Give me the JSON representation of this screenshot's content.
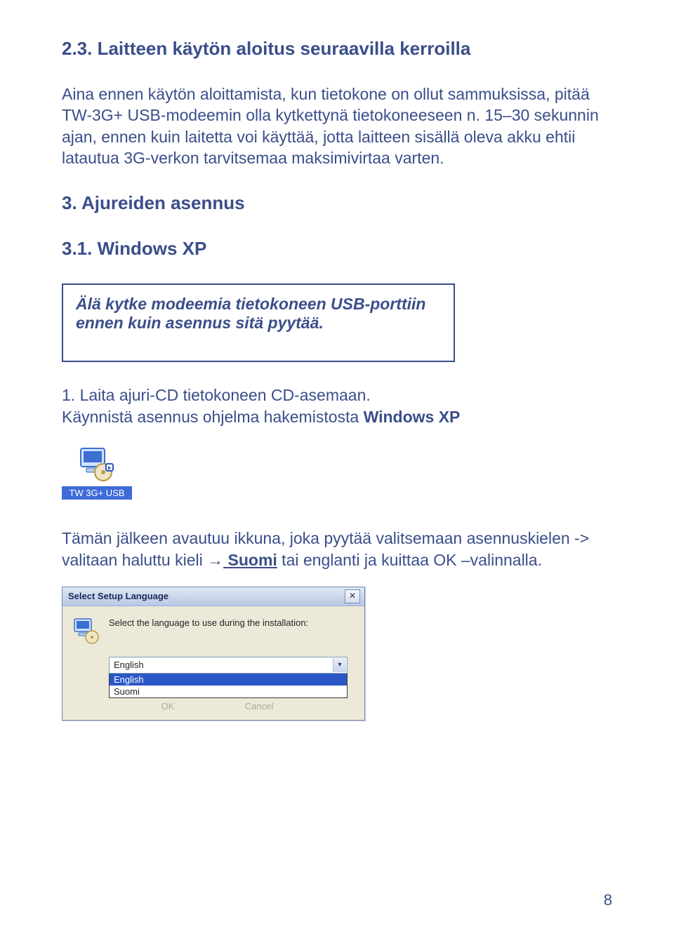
{
  "headings": {
    "h_23": "2.3. Laitteen käytön aloitus seuraavilla kerroilla",
    "h_3": "3. Ajureiden asennus",
    "h_31": "3.1. Windows XP"
  },
  "paragraphs": {
    "intro": "Aina ennen käytön aloittamista, kun tietokone on ollut sammuksissa, pitää TW-3G+ USB-modeemin olla kytkettynä tietokoneeseen n. 15–30 sekunnin ajan, ennen kuin laitetta voi käyttää, jotta laitteen sisällä oleva akku ehtii latautua 3G-verkon tarvitsemaa maksimivirtaa varten.",
    "callout": "Älä kytke modeemia tietokoneen USB-porttiin ennen kuin asennus sitä pyytää.",
    "step1_a": "1. Laita ajuri-CD tietokoneen CD-asemaan.",
    "step1_b_pre": "Käynnistä asennus ohjelma hakemistosta ",
    "step1_b_bold": "Windows XP",
    "after_icon_pre": "Tämän jälkeen avautuu ikkuna, joka pyytää valitsemaan asennuskielen -> valitaan haluttu kieli ",
    "arrow": "→",
    "lang_word": " Suomi",
    "after_lang": " tai englanti ja kuittaa OK –valinnalla."
  },
  "desktop_icon": {
    "label": "TW 3G+ USB"
  },
  "dialog": {
    "title": "Select Setup Language",
    "prompt": "Select the language to use during the installation:",
    "selected": "English",
    "options": [
      "English",
      "Suomi"
    ],
    "ok": "OK",
    "cancel": "Cancel",
    "close_glyph": "✕",
    "dropdown_glyph": "▾"
  },
  "page_number": "8"
}
